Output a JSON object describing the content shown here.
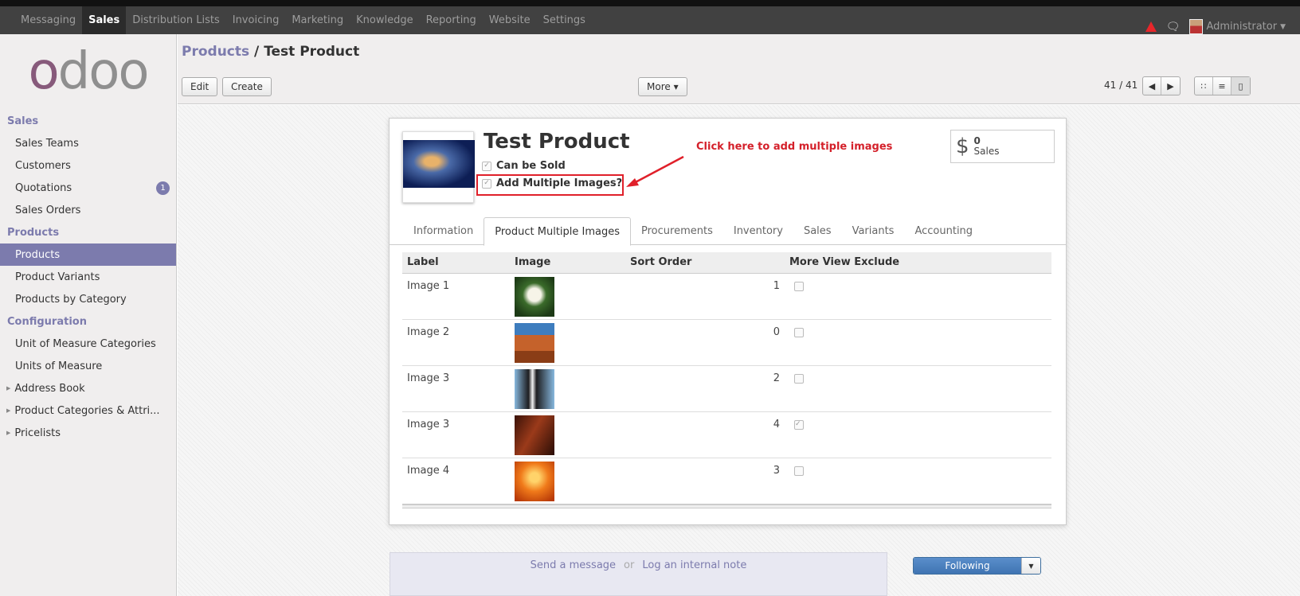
{
  "topbar": {
    "menu": [
      "Messaging",
      "Sales",
      "Distribution Lists",
      "Invoicing",
      "Marketing",
      "Knowledge",
      "Reporting",
      "Website",
      "Settings"
    ],
    "active": "Sales",
    "user": "Administrator",
    "icons": [
      "warning-icon",
      "chat-icon",
      "user-avatar"
    ]
  },
  "sidebar": {
    "logo": "odoo",
    "sections": [
      {
        "title": "Sales",
        "items": [
          "Sales Teams",
          "Customers",
          "Quotations",
          "Sales Orders"
        ]
      },
      {
        "title": "Products",
        "items": [
          "Products",
          "Product Variants",
          "Products by Category"
        ]
      },
      {
        "title": "Configuration",
        "items": [
          "Unit of Measure Categories",
          "Units of Measure"
        ]
      }
    ],
    "collapsed_items": [
      "Address Book",
      "Product Categories & Attri...",
      "Pricelists"
    ],
    "quotations_badge": "1",
    "active_item": "Products"
  },
  "control_panel": {
    "breadcrumb_link": "Products",
    "breadcrumb_sep": "/",
    "breadcrumb_current": "Test Product",
    "edit_label": "Edit",
    "create_label": "Create",
    "more_label": "More ▾",
    "pager": "41 / 41"
  },
  "form": {
    "product_name": "Test Product",
    "can_be_sold_label": "Can be Sold",
    "add_multiple_images_label": "Add Multiple Images?",
    "annotation": "Click here to add multiple images",
    "stat_value": "0",
    "stat_label": "Sales",
    "tabs": [
      "Information",
      "Product Multiple Images",
      "Procurements",
      "Inventory",
      "Sales",
      "Variants",
      "Accounting"
    ],
    "active_tab": "Product Multiple Images",
    "columns": [
      "Label",
      "Image",
      "Sort Order",
      "More View Exclude"
    ],
    "rows": [
      {
        "label": "Image 1",
        "sort": "1",
        "exclude": false
      },
      {
        "label": "Image 2",
        "sort": "0",
        "exclude": false
      },
      {
        "label": "Image 3",
        "sort": "2",
        "exclude": false
      },
      {
        "label": "Image 3",
        "sort": "4",
        "exclude": true
      },
      {
        "label": "Image 4",
        "sort": "3",
        "exclude": false
      }
    ]
  },
  "chatter": {
    "send_message": "Send a message",
    "or": "or",
    "log_note": "Log an internal note",
    "following": "Following"
  },
  "colors": {
    "accent": "#7c7bad",
    "annotation": "#e0202a",
    "topbar": "#414141"
  }
}
